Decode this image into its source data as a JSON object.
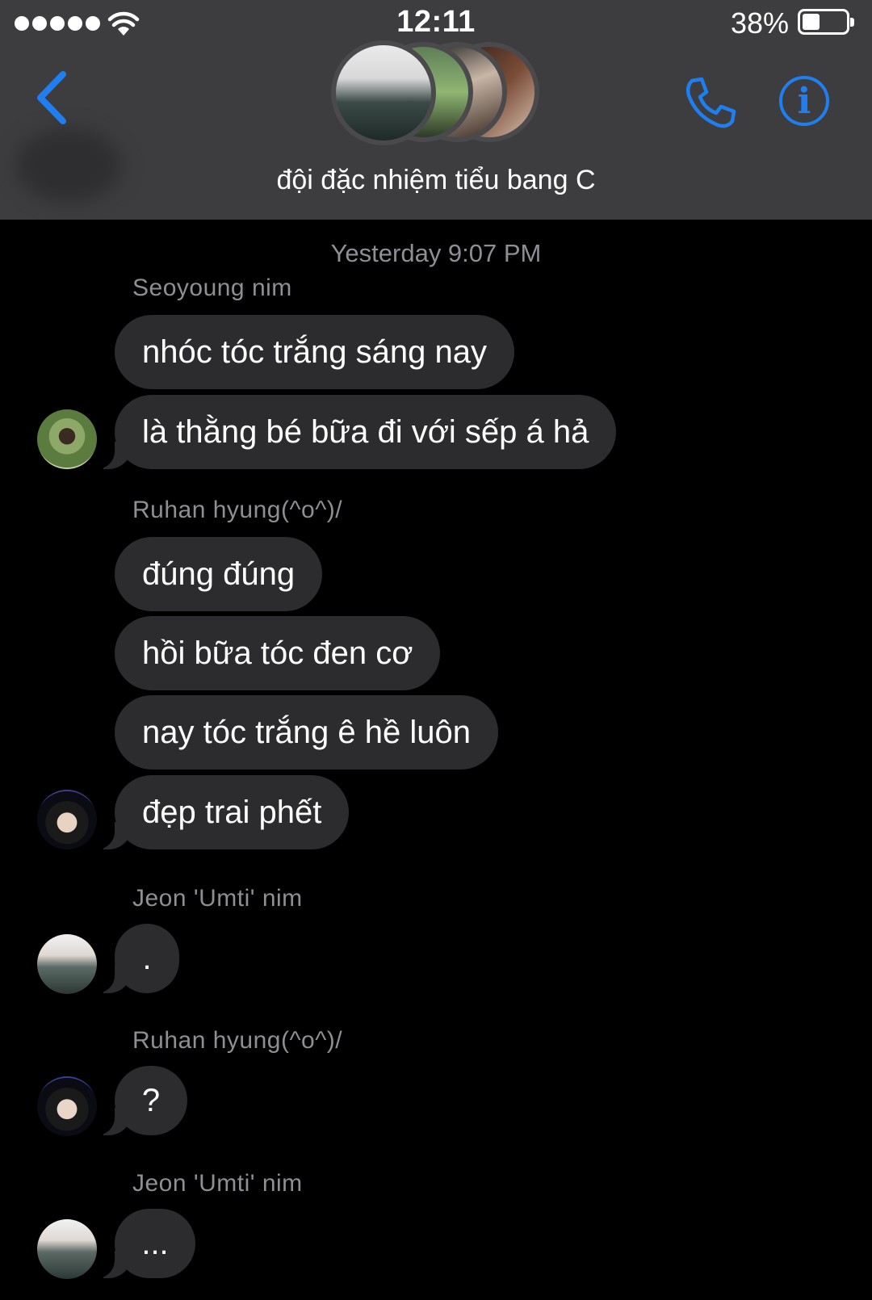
{
  "status_bar": {
    "time": "12:11",
    "battery": "38%",
    "battery_level": 0.38
  },
  "header": {
    "group_name": "đội đặc nhiệm tiểu bang C",
    "accent_color": "#1f7ff0",
    "back_icon": "chevron-left-icon",
    "call_icon": "phone-icon",
    "info_icon": "info-icon",
    "info_glyph": "i"
  },
  "conversation": {
    "timestamp": "Yesterday 9:07 PM",
    "groups": [
      {
        "sender": "Seoyoung nim",
        "messages": [
          "nhóc tóc trắng sáng nay",
          "là thằng bé bữa đi với sếp á hả"
        ]
      },
      {
        "sender": "Ruhan hyung(^o^)/",
        "messages": [
          "đúng đúng",
          "hồi bữa tóc đen cơ",
          "nay tóc trắng ê hề luôn",
          "đẹp trai phết"
        ]
      },
      {
        "sender": "Jeon 'Umti' nim",
        "messages": [
          "."
        ]
      },
      {
        "sender": "Ruhan hyung(^o^)/",
        "messages": [
          "?"
        ]
      },
      {
        "sender": "Jeon 'Umti' nim",
        "messages": [
          "..."
        ]
      }
    ]
  }
}
